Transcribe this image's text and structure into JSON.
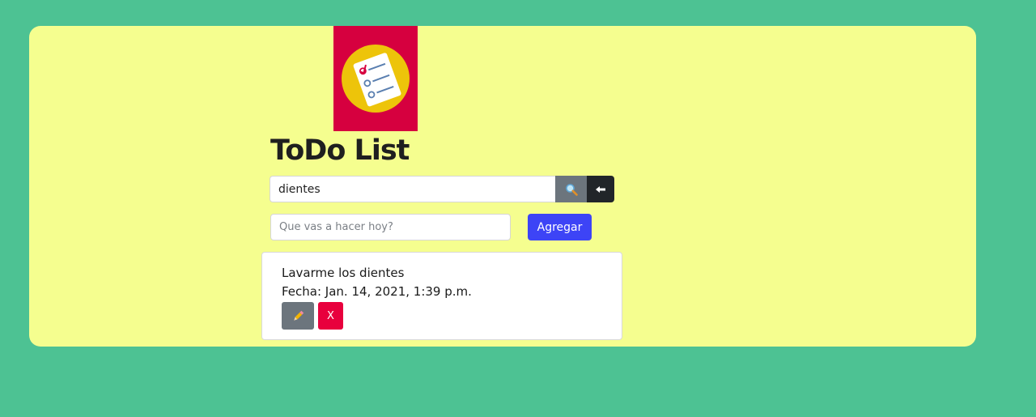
{
  "header": {
    "title": "ToDo List"
  },
  "search": {
    "value": "dientes",
    "search_icon": "magnifier-icon",
    "back_icon": "arrow-left-icon"
  },
  "new_task": {
    "placeholder": "Que vas a hacer hoy?",
    "add_label": "Agregar"
  },
  "todos": [
    {
      "text": "Lavarme los dientes",
      "date": "Fecha: Jan. 14, 2021, 1:39 p.m.",
      "edit_icon": "pencil-icon",
      "delete_label": "X"
    }
  ],
  "colors": {
    "background": "#4dc293",
    "card": "#f5fe8f",
    "logo_bg": "#d6003f",
    "add_button": "#3d44f6",
    "delete_button": "#e8003d",
    "search_button": "#6c757d",
    "back_button": "#212529"
  }
}
